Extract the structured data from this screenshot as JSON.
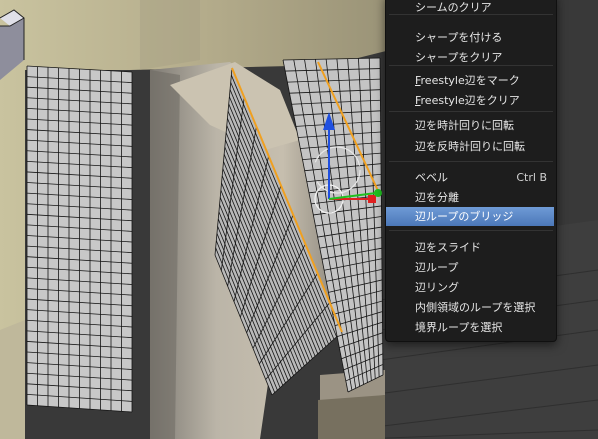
{
  "menu": {
    "items": [
      {
        "label": "シームのクリア"
      },
      {
        "label": "シャープを付ける"
      },
      {
        "label": "シャープをクリア"
      },
      {
        "label": "Freestyle辺をマーク",
        "accel": "F"
      },
      {
        "label": "Freestyle辺をクリア",
        "accel": "F"
      },
      {
        "label": "辺を時計回りに回転"
      },
      {
        "label": "辺を反時計回りに回転"
      },
      {
        "label": "ベベル",
        "shortcut": "Ctrl B"
      },
      {
        "label": "辺を分離"
      },
      {
        "label": "辺ループのブリッジ",
        "active": true
      },
      {
        "label": "辺をスライド"
      },
      {
        "label": "辺ループ"
      },
      {
        "label": "辺リング"
      },
      {
        "label": "内側領域のループを選択"
      },
      {
        "label": "境界ループを選択"
      }
    ]
  },
  "colors": {
    "menu_bg": "#1d1d1d",
    "highlight": "#5a87c8",
    "selected_edge": "#f0a020",
    "gizmo_z": "#2050e0",
    "gizmo_x": "#e02020",
    "gizmo_y": "#20c020",
    "mesh_face": "#c9c9c9",
    "wireframe": "#111111"
  }
}
